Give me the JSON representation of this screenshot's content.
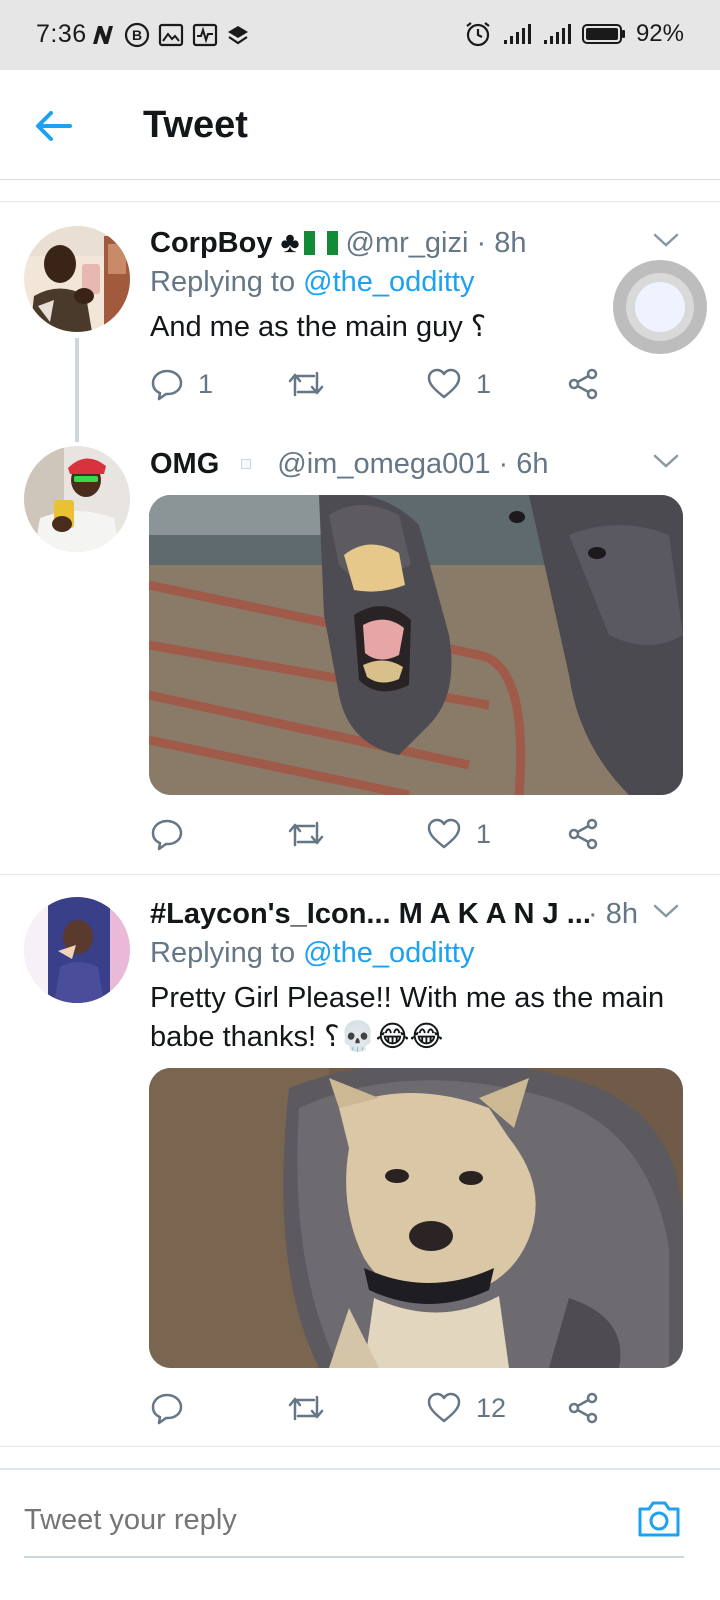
{
  "status_bar": {
    "time": "7:36",
    "battery": "92%",
    "left_icons": [
      "n-icon",
      "b-badge-icon",
      "image-icon",
      "activity-icon",
      "layers-icon"
    ],
    "right_icons": [
      "alarm-icon",
      "signal-icon",
      "signal-icon",
      "battery-icon"
    ]
  },
  "header": {
    "title": "Tweet"
  },
  "tweets": [
    {
      "name": "CorpBoy ♣",
      "handle": "@mr_gizi · 8h",
      "replying_prefix": "Replying to",
      "replying_to": "@the_odditty",
      "text": "And me as the main guy ⸮",
      "reply_count": "1",
      "like_count": "1"
    },
    {
      "name": "OMG",
      "handle": "@im_omega001 · 6h",
      "like_count": "1"
    },
    {
      "name": "#Laycon's_Icon... M A K A N J ...",
      "handle": "· 8h",
      "replying_prefix": "Replying to",
      "replying_to": "@the_odditty",
      "text": "Pretty Girl Please!! With me as the main babe thanks! ⸮💀😂😂",
      "like_count": "12"
    }
  ],
  "compose": {
    "placeholder": "Tweet your reply"
  },
  "colors": {
    "accent": "#1da1f2",
    "secondary_text": "#657786",
    "primary_text": "#14171a",
    "divider": "#e1e8ed"
  }
}
